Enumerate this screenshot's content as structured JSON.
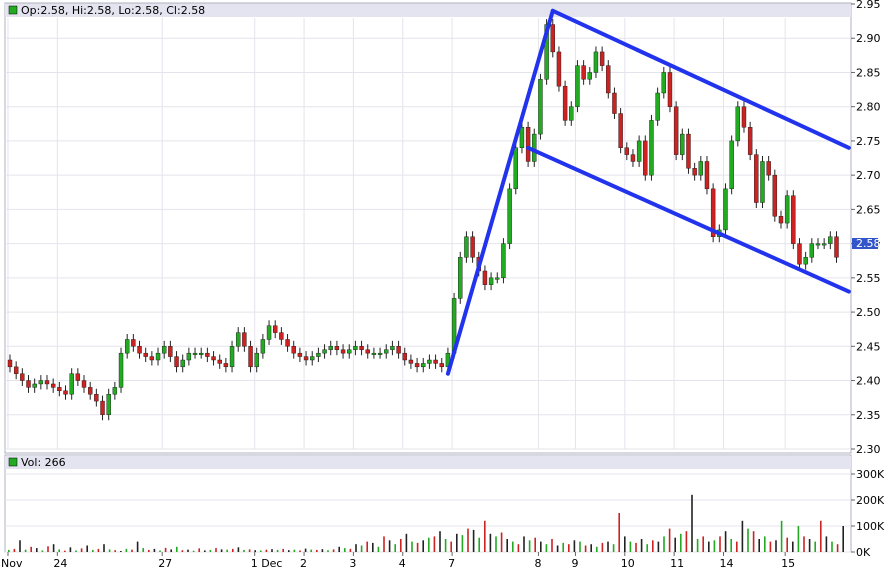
{
  "chart_data": [
    {
      "type": "candlestick",
      "header": {
        "open": "Op:2.58",
        "high": "Hi:2.58",
        "low": "Lo:2.58",
        "close": "Cl:2.58"
      },
      "ylim": [
        2.3,
        2.95
      ],
      "y_ticks": [
        "2.95",
        "2.90",
        "2.85",
        "2.80",
        "2.75",
        "2.70",
        "2.65",
        "2.60",
        "2.55",
        "2.50",
        "2.45",
        "2.40",
        "2.35",
        "2.30"
      ],
      "last_price_label": "2.58",
      "x_tick_labels": [
        "Nov",
        "24",
        "27",
        "1 Dec",
        "2",
        "3",
        "4",
        "7",
        "8",
        "9",
        "10",
        "11",
        "14",
        "15"
      ],
      "price_path": [
        [
          0,
          2.43
        ],
        [
          2,
          2.41
        ],
        [
          4,
          2.39
        ],
        [
          6,
          2.4
        ],
        [
          8,
          2.39
        ],
        [
          10,
          2.38
        ],
        [
          11,
          2.41
        ],
        [
          13,
          2.39
        ],
        [
          15,
          2.37
        ],
        [
          16,
          2.35
        ],
        [
          17,
          2.38
        ],
        [
          18,
          2.39
        ],
        [
          19,
          2.44
        ],
        [
          20,
          2.46
        ],
        [
          22,
          2.44
        ],
        [
          24,
          2.43
        ],
        [
          26,
          2.45
        ],
        [
          28,
          2.42
        ],
        [
          30,
          2.44
        ],
        [
          32,
          2.44
        ],
        [
          34,
          2.43
        ],
        [
          36,
          2.42
        ],
        [
          37,
          2.45
        ],
        [
          38,
          2.47
        ],
        [
          39,
          2.45
        ],
        [
          40,
          2.42
        ],
        [
          41,
          2.44
        ],
        [
          43,
          2.48
        ],
        [
          45,
          2.46
        ],
        [
          47,
          2.44
        ],
        [
          49,
          2.43
        ],
        [
          51,
          2.44
        ],
        [
          53,
          2.45
        ],
        [
          55,
          2.44
        ],
        [
          57,
          2.45
        ],
        [
          59,
          2.44
        ],
        [
          61,
          2.44
        ],
        [
          63,
          2.45
        ],
        [
          65,
          2.43
        ],
        [
          67,
          2.42
        ],
        [
          69,
          2.43
        ],
        [
          71,
          2.42
        ],
        [
          72,
          2.44
        ],
        [
          73,
          2.52
        ],
        [
          74,
          2.58
        ],
        [
          75,
          2.61
        ],
        [
          76,
          2.58
        ],
        [
          77,
          2.56
        ],
        [
          78,
          2.54
        ],
        [
          79,
          2.55
        ],
        [
          80,
          2.55
        ],
        [
          81,
          2.6
        ],
        [
          82,
          2.68
        ],
        [
          83,
          2.74
        ],
        [
          84,
          2.77
        ],
        [
          85,
          2.72
        ],
        [
          86,
          2.76
        ],
        [
          87,
          2.84
        ],
        [
          88,
          2.92
        ],
        [
          89,
          2.88
        ],
        [
          90,
          2.83
        ],
        [
          91,
          2.78
        ],
        [
          92,
          2.8
        ],
        [
          93,
          2.86
        ],
        [
          94,
          2.84
        ],
        [
          95,
          2.85
        ],
        [
          96,
          2.88
        ],
        [
          97,
          2.86
        ],
        [
          98,
          2.82
        ],
        [
          99,
          2.79
        ],
        [
          100,
          2.74
        ],
        [
          101,
          2.73
        ],
        [
          102,
          2.72
        ],
        [
          103,
          2.75
        ],
        [
          104,
          2.7
        ],
        [
          105,
          2.78
        ],
        [
          106,
          2.82
        ],
        [
          107,
          2.85
        ],
        [
          108,
          2.8
        ],
        [
          109,
          2.73
        ],
        [
          110,
          2.76
        ],
        [
          111,
          2.71
        ],
        [
          112,
          2.7
        ],
        [
          113,
          2.72
        ],
        [
          114,
          2.68
        ],
        [
          115,
          2.61
        ],
        [
          116,
          2.62
        ],
        [
          117,
          2.68
        ],
        [
          118,
          2.75
        ],
        [
          119,
          2.8
        ],
        [
          120,
          2.77
        ],
        [
          121,
          2.73
        ],
        [
          122,
          2.66
        ],
        [
          123,
          2.72
        ],
        [
          124,
          2.7
        ],
        [
          125,
          2.64
        ],
        [
          126,
          2.63
        ],
        [
          127,
          2.67
        ],
        [
          128,
          2.6
        ],
        [
          129,
          2.57
        ],
        [
          130,
          2.58
        ],
        [
          131,
          2.6
        ],
        [
          132,
          2.6
        ],
        [
          133,
          2.6
        ],
        [
          134,
          2.61
        ],
        [
          135,
          2.58
        ]
      ],
      "volume": {
        "label": "Vol: 266",
        "ylim": [
          0,
          300000
        ],
        "y_ticks": [
          "300K",
          "200K",
          "100K",
          "0K"
        ],
        "values": [
          8000,
          12000,
          45000,
          9000,
          20000,
          15000,
          6000,
          22000,
          30000,
          10000,
          5000,
          18000,
          6000,
          14000,
          25000,
          8000,
          12000,
          30000,
          10000,
          7000,
          4000,
          12000,
          9000,
          40000,
          15000,
          8000,
          12000,
          6000,
          16000,
          10000,
          20000,
          7000,
          9000,
          5000,
          14000,
          6000,
          8000,
          15000,
          10000,
          9000,
          12000,
          18000,
          8000,
          10000,
          7000,
          6000,
          9000,
          11000,
          8000,
          12000,
          7000,
          9000,
          6000,
          13000,
          9000,
          8000,
          11000,
          7000,
          10000,
          20000,
          15000,
          12000,
          30000,
          25000,
          40000,
          35000,
          20000,
          60000,
          45000,
          30000,
          50000,
          70000,
          40000,
          35000,
          45000,
          55000,
          60000,
          80000,
          50000,
          40000,
          70000,
          65000,
          90000,
          85000,
          55000,
          120000,
          70000,
          60000,
          75000,
          50000,
          40000,
          30000,
          60000,
          45000,
          55000,
          40000,
          30000,
          50000,
          25000,
          35000,
          30000,
          45000,
          40000,
          25000,
          30000,
          20000,
          35000,
          40000,
          30000,
          150000,
          60000,
          40000,
          35000,
          50000,
          30000,
          45000,
          40000,
          60000,
          90000,
          55000,
          70000,
          80000,
          220000,
          50000,
          60000,
          40000,
          45000,
          60000,
          80000,
          50000,
          40000,
          120000,
          90000,
          80000,
          50000,
          60000,
          40000,
          45000,
          120000,
          55000,
          40000,
          100000,
          60000,
          50000,
          40000,
          120000,
          60000,
          40000,
          30000,
          100000
        ]
      },
      "trendlines": [
        {
          "p1": [
            71,
            2.41
          ],
          "p2": [
            88,
            2.94
          ]
        },
        {
          "p1": [
            88,
            2.94
          ],
          "p2": [
            136,
            2.74
          ]
        },
        {
          "p1": [
            84,
            2.74
          ],
          "p2": [
            136,
            2.53
          ]
        }
      ]
    }
  ]
}
